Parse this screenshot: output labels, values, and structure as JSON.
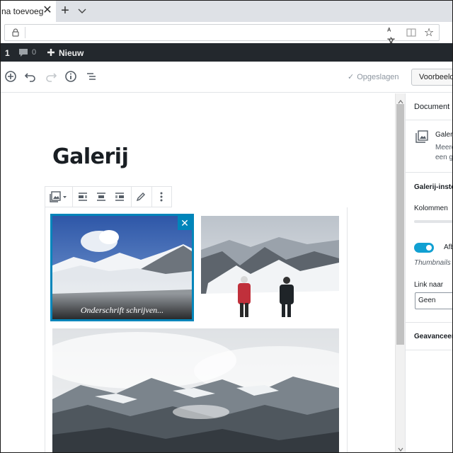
{
  "browser": {
    "tab_title": "na toevoeg",
    "tab_close": "✕",
    "new_tab": "+",
    "translate_glyph": "ᴬ文",
    "star": "☆"
  },
  "adminbar": {
    "updates_count": "1",
    "comments_count": "0",
    "new_label": "Nieuw"
  },
  "header": {
    "saved_label": "Opgeslagen",
    "saved_icon": "✓",
    "preview_label": "Voorbeeld"
  },
  "post": {
    "title": "Galerij"
  },
  "gallery": {
    "selected_caption_placeholder": "Onderschrift schrijven...",
    "remove_glyph": "✕"
  },
  "sidebar": {
    "tab_document": "Document",
    "block_title": "Galeri",
    "block_desc_line1": "Meerd",
    "block_desc_line2": "een g",
    "panel_title": "Galerij-inste",
    "columns_label": "Kolommen",
    "crop_label": "Afb",
    "crop_help": "Thumbnails a",
    "link_label": "Link naar",
    "link_value": "Geen",
    "advanced_label": "Geavanceerd"
  },
  "colors": {
    "accent": "#0085ba",
    "toggle": "#11a0d2",
    "adminbar": "#23282d"
  }
}
